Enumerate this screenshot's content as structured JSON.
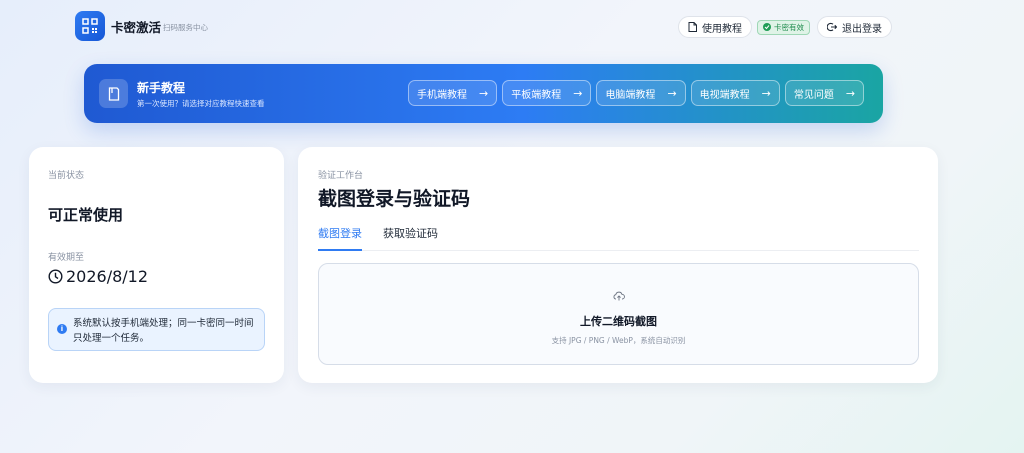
{
  "brand": {
    "name": "卡密激活",
    "subtitle": "扫码服务中心"
  },
  "header": {
    "tutorial_label": "使用教程",
    "card_status_badge": "卡密有效",
    "logout_label": "退出登录"
  },
  "banner": {
    "title": "新手教程",
    "subtitle": "第一次使用？请选择对应教程快速查看",
    "links": [
      {
        "label": "手机端教程",
        "arrow": "→"
      },
      {
        "label": "平板端教程",
        "arrow": "→"
      },
      {
        "label": "电脑端教程",
        "arrow": "→"
      },
      {
        "label": "电视端教程",
        "arrow": "→"
      },
      {
        "label": "常见问题",
        "arrow": "→"
      }
    ]
  },
  "status_card": {
    "current_status_label": "当前状态",
    "current_status_value": "可正常使用",
    "expiry_label": "有效期至",
    "expiry_date": "2026/8/12",
    "notice": "系统默认按手机端处理；同一卡密同一时间只处理一个任务。"
  },
  "workbench": {
    "section_label": "验证工作台",
    "title": "截图登录与验证码",
    "tabs": [
      {
        "label": "截图登录",
        "active": true
      },
      {
        "label": "获取验证码",
        "active": false
      }
    ],
    "upload": {
      "title": "上传二维码截图",
      "hint": "支持 JPG / PNG / WebP，系统自动识别"
    }
  },
  "icons": {
    "logo": "qr-code-icon",
    "tutorial": "document-icon",
    "badge": "check-circle-icon",
    "logout": "logout-icon",
    "banner": "book-icon",
    "clock": "clock-icon",
    "info": "info-icon",
    "upload": "cloud-upload-icon"
  },
  "colors": {
    "accent": "#2f7bf2",
    "success": "#1f9d55",
    "banner_start": "#1f59d2",
    "banner_end": "#1aa5a3"
  }
}
